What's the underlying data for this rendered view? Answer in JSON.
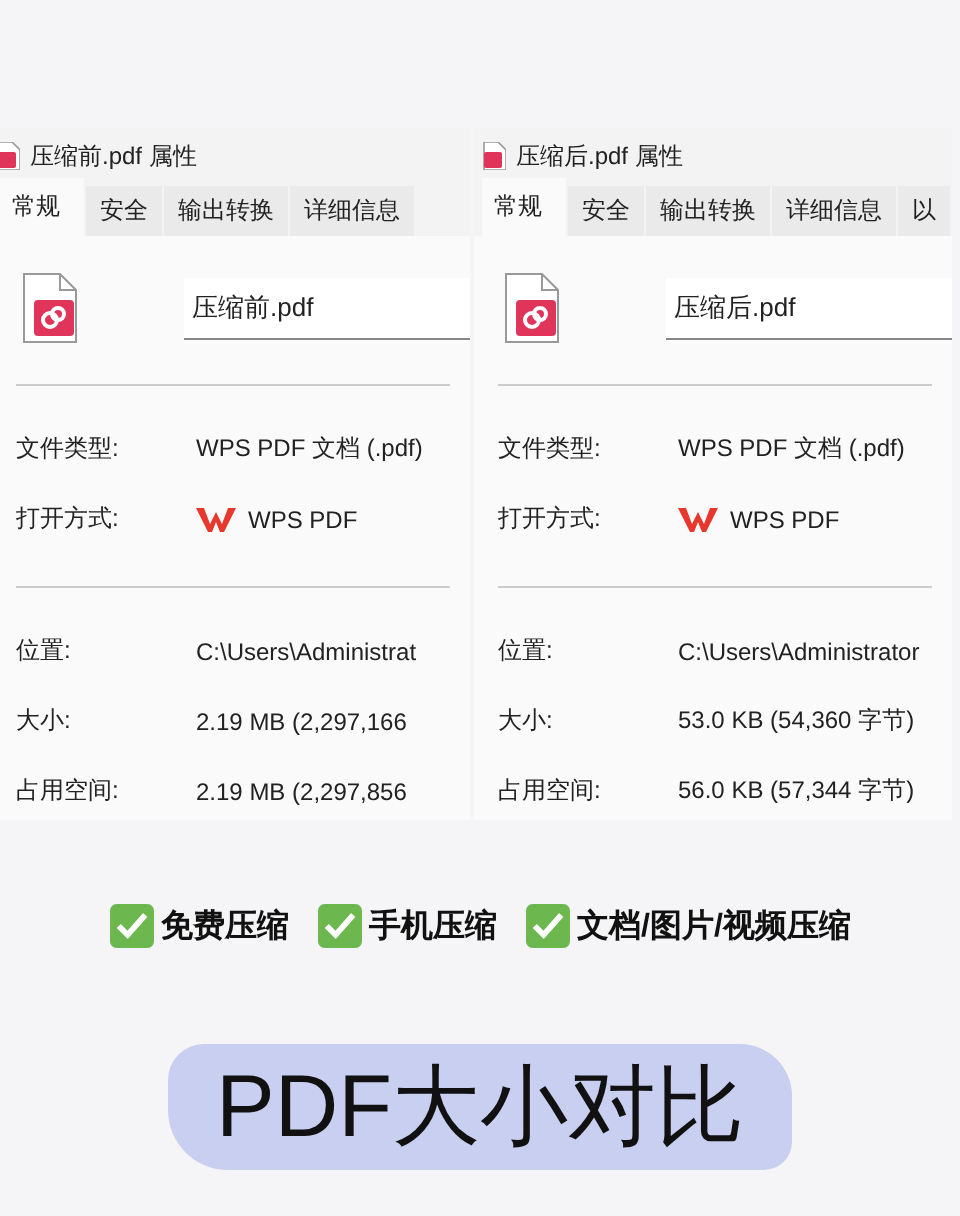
{
  "dialogs": [
    {
      "title": "压缩前.pdf 属性",
      "tabs": [
        {
          "label": "常规",
          "selected": true
        },
        {
          "label": "安全",
          "selected": false
        },
        {
          "label": "输出转换",
          "selected": false
        },
        {
          "label": "详细信息",
          "selected": false
        }
      ],
      "file_name": "压缩前.pdf",
      "rows_top": [
        {
          "label": "文件类型:",
          "value": "WPS PDF 文档 (.pdf)",
          "kind": "text"
        },
        {
          "label": "打开方式:",
          "value": "WPS PDF",
          "kind": "app"
        }
      ],
      "rows_bottom": [
        {
          "label": "位置:",
          "value": "C:\\Users\\Administrat"
        },
        {
          "label": "大小:",
          "value": "2.19 MB (2,297,166"
        },
        {
          "label": "占用空间:",
          "value": "2.19 MB (2,297,856"
        }
      ]
    },
    {
      "title": "压缩后.pdf 属性",
      "tabs": [
        {
          "label": "常规",
          "selected": true
        },
        {
          "label": "安全",
          "selected": false
        },
        {
          "label": "输出转换",
          "selected": false
        },
        {
          "label": "详细信息",
          "selected": false
        },
        {
          "label": "以",
          "selected": false
        }
      ],
      "file_name": "压缩后.pdf",
      "rows_top": [
        {
          "label": "文件类型:",
          "value": "WPS PDF 文档 (.pdf)",
          "kind": "text"
        },
        {
          "label": "打开方式:",
          "value": "WPS PDF",
          "kind": "app"
        }
      ],
      "rows_bottom": [
        {
          "label": "位置:",
          "value": "C:\\Users\\Administrator"
        },
        {
          "label": "大小:",
          "value": "53.0 KB (54,360 字节)"
        },
        {
          "label": "占用空间:",
          "value": "56.0 KB (57,344 字节)"
        }
      ]
    }
  ],
  "features": [
    {
      "label": "免费压缩",
      "checked": true
    },
    {
      "label": "手机压缩",
      "checked": true
    },
    {
      "label": "文档/图片/视频压缩",
      "checked": true
    }
  ],
  "headline": "PDF大小对比"
}
